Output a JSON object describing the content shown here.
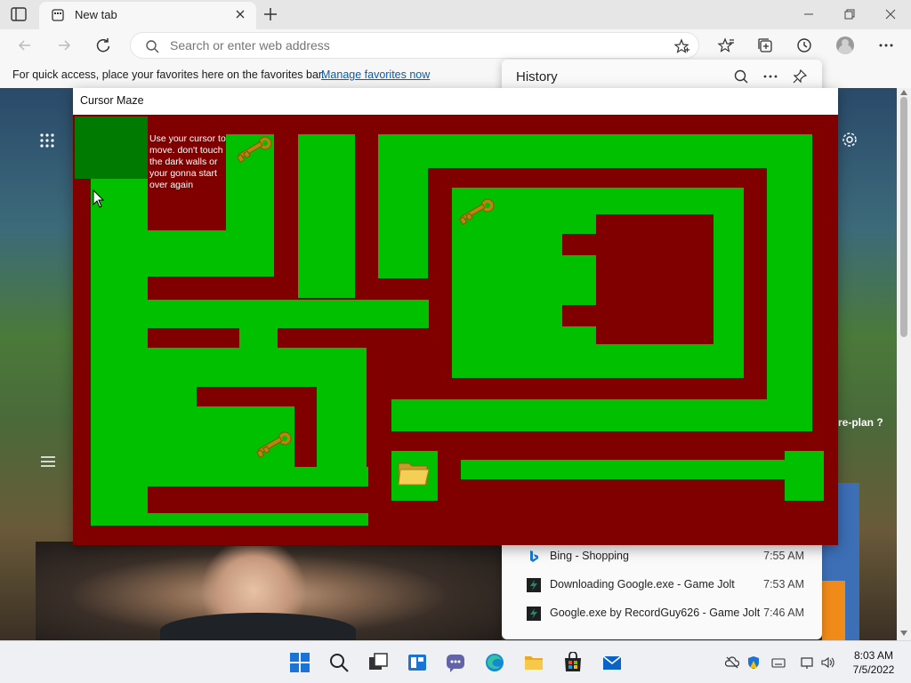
{
  "browser": {
    "tab": {
      "title": "New tab"
    },
    "address": {
      "placeholder": "Search or enter web address"
    },
    "favorites_bar": {
      "text": "For quick access, place your favorites here on the favorites bar.",
      "link": "Manage favorites now"
    }
  },
  "history": {
    "title": "History",
    "items": [
      {
        "name": "Bing - Shopping",
        "time": "7:55 AM",
        "icon": "bing-icon"
      },
      {
        "name": "Downloading Google.exe - Game Jolt",
        "time": "7:53 AM",
        "icon": "gamejolt-icon"
      },
      {
        "name": "Google.exe by RecordGuy626 - Game Jolt",
        "time": "7:46 AM",
        "icon": "gamejolt-icon"
      }
    ]
  },
  "newtab_page": {
    "replan_text": "re-plan ?"
  },
  "maze": {
    "window_title": "Cursor Maze",
    "instructions": "Use your cursor to move. don't touch the dark walls or your gonna start over again",
    "colors": {
      "wall": "#800000",
      "path": "#00c000",
      "start": "#007a00"
    }
  },
  "taskbar": {
    "time": "8:03 AM",
    "date": "7/5/2022"
  }
}
